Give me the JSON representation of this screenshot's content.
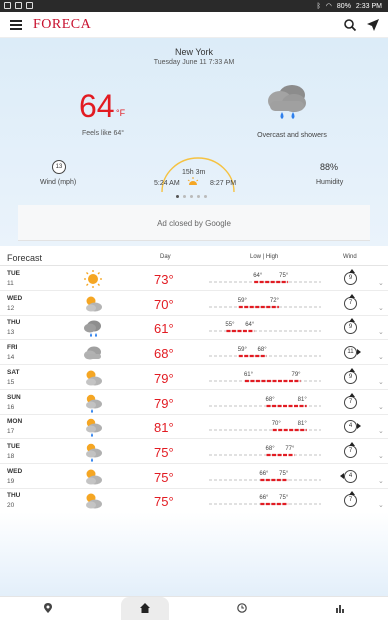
{
  "status_bar": {
    "battery": "80%",
    "time": "2:33 PM"
  },
  "app": {
    "name": "FORECA"
  },
  "icons": {
    "menu": "hamburger-icon",
    "search": "search-icon",
    "location": "navigation-arrow-icon"
  },
  "current": {
    "city": "New York",
    "datetime": "Tuesday June 11 7:33 AM",
    "temp": "64",
    "unit": "°F",
    "feels_like": "Feels like 64°",
    "condition": "Overcast and showers",
    "wind_speed": "13",
    "wind_label": "Wind (mph)",
    "day_length": "15h 3m",
    "sunrise": "5:24 AM",
    "sunset": "8:27 PM",
    "humidity": "88%",
    "humidity_label": "Humidity"
  },
  "ad": {
    "text": "Ad closed by Google"
  },
  "forecast": {
    "title": "Forecast",
    "col_day": "Day",
    "col_lowhigh": "Low | High",
    "col_wind": "Wind",
    "scale_min": 50,
    "scale_max": 85,
    "days": [
      {
        "name": "TUE",
        "date": "11",
        "icon": "sunny-icon",
        "temp": "73°",
        "low": "64°",
        "high": "75°",
        "low_v": 64,
        "high_v": 75,
        "wind": "9",
        "dir": "up"
      },
      {
        "name": "WED",
        "date": "12",
        "icon": "partly-cloudy-icon",
        "temp": "70°",
        "low": "59°",
        "high": "72°",
        "low_v": 59,
        "high_v": 72,
        "wind": "7",
        "dir": "up"
      },
      {
        "name": "THU",
        "date": "13",
        "icon": "cloud-rain-icon",
        "temp": "61°",
        "low": "55°",
        "high": "64°",
        "low_v": 55,
        "high_v": 64,
        "wind": "9",
        "dir": "up"
      },
      {
        "name": "FRI",
        "date": "14",
        "icon": "cloudy-icon",
        "temp": "68°",
        "low": "59°",
        "high": "68°",
        "low_v": 59,
        "high_v": 68,
        "wind": "11",
        "dir": "right"
      },
      {
        "name": "SAT",
        "date": "15",
        "icon": "partly-cloudy-icon",
        "temp": "79°",
        "low": "61°",
        "high": "79°",
        "low_v": 61,
        "high_v": 79,
        "wind": "9",
        "dir": "up"
      },
      {
        "name": "SUN",
        "date": "16",
        "icon": "partly-cloudy-rain-icon",
        "temp": "79°",
        "low": "68°",
        "high": "81°",
        "low_v": 68,
        "high_v": 81,
        "wind": "7",
        "dir": "up"
      },
      {
        "name": "MON",
        "date": "17",
        "icon": "partly-cloudy-rain-icon",
        "temp": "81°",
        "low": "70°",
        "high": "81°",
        "low_v": 70,
        "high_v": 81,
        "wind": "4",
        "dir": "right"
      },
      {
        "name": "TUE",
        "date": "18",
        "icon": "partly-cloudy-rain-icon",
        "temp": "75°",
        "low": "68°",
        "high": "77°",
        "low_v": 68,
        "high_v": 77,
        "wind": "7",
        "dir": "up"
      },
      {
        "name": "WED",
        "date": "19",
        "icon": "partly-cloudy-icon",
        "temp": "75°",
        "low": "66°",
        "high": "75°",
        "low_v": 66,
        "high_v": 75,
        "wind": "4",
        "dir": "left"
      },
      {
        "name": "THU",
        "date": "20",
        "icon": "partly-cloudy-icon",
        "temp": "75°",
        "low": "66°",
        "high": "75°",
        "low_v": 66,
        "high_v": 75,
        "wind": "7",
        "dir": "up"
      }
    ]
  },
  "bottom_nav": [
    {
      "icon": "location-pin-icon",
      "active": false
    },
    {
      "icon": "home-icon",
      "active": true
    },
    {
      "icon": "clock-icon",
      "active": false
    },
    {
      "icon": "bar-chart-icon",
      "active": false
    }
  ],
  "colors": {
    "accent": "#e21b22",
    "sun": "#f5a623",
    "cloud": "#9a9a9a",
    "rain": "#2f80ed"
  }
}
